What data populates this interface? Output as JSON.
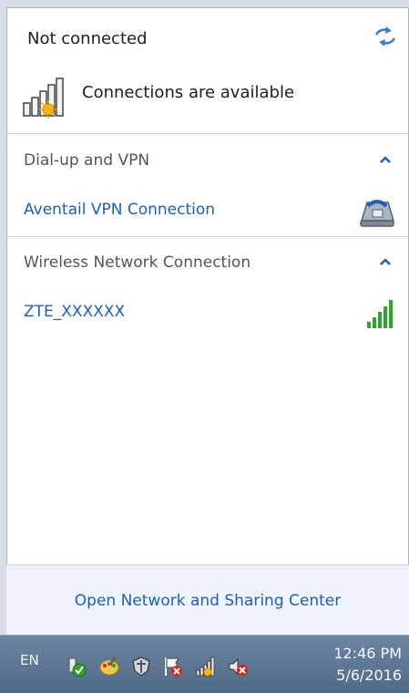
{
  "status": {
    "title": "Not connected",
    "subtitle": "Connections are available"
  },
  "sections": [
    {
      "header": "Dial-up and VPN",
      "items": [
        {
          "label": "Aventail VPN Connection",
          "icon": "phone-modem-icon"
        }
      ]
    },
    {
      "header": "Wireless Network Connection",
      "items": [
        {
          "label": "ZTE_XXXXXX",
          "icon": "wifi-signal-icon",
          "signal": "full"
        }
      ]
    }
  ],
  "footer": {
    "link": "Open Network and Sharing Center"
  },
  "taskbar": {
    "language": "EN",
    "time": "12:46 PM",
    "date": "5/6/2016",
    "tray_icons": [
      "usb-safe-remove-icon",
      "paint-icon",
      "security-shield-icon",
      "action-center-flag-icon",
      "network-icon",
      "volume-muted-icon"
    ]
  },
  "colors": {
    "link": "#1f5fb8",
    "signal_green": "#2fa22f",
    "taskbar": "#5e7895",
    "error_red": "#d9241c"
  }
}
